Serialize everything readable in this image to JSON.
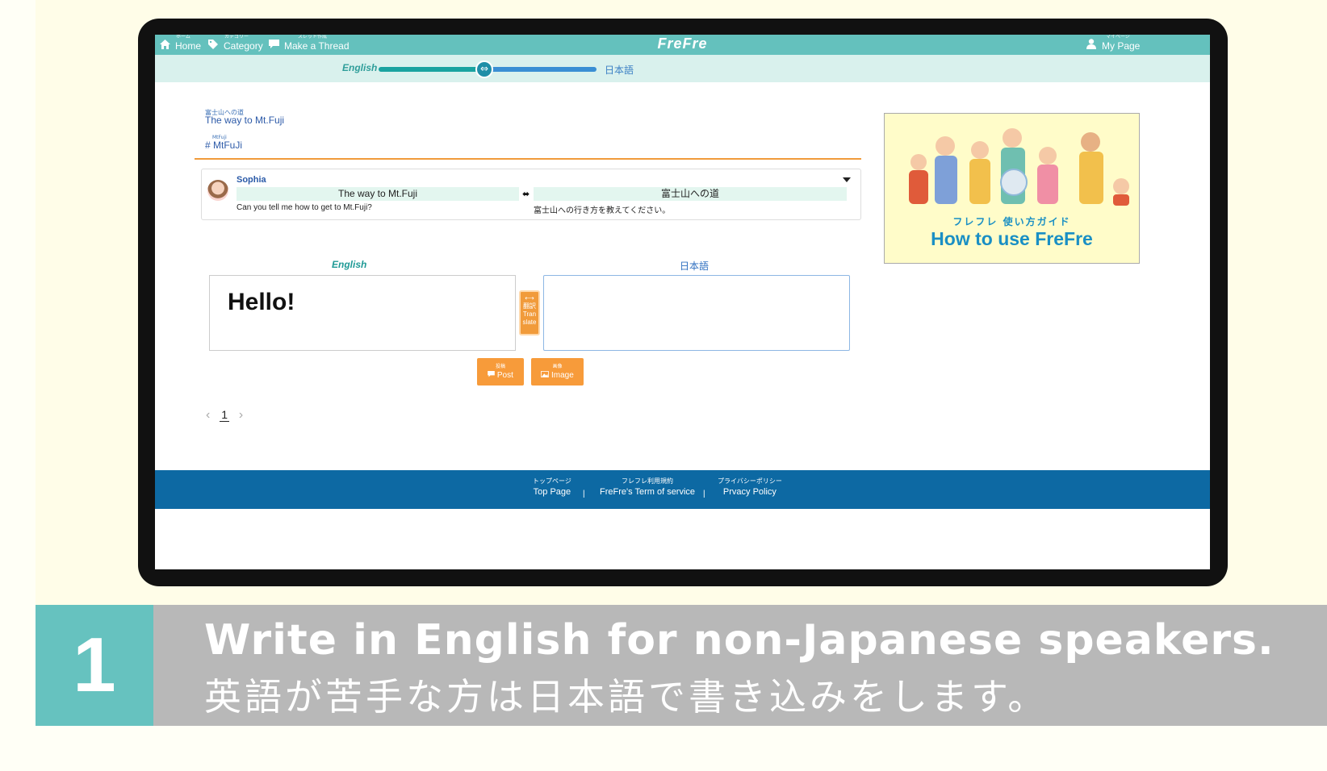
{
  "nav": {
    "home": {
      "ruby": "ホーム",
      "label": "Home"
    },
    "category": {
      "ruby": "カテゴリー",
      "label": "Category"
    },
    "make_thread": {
      "ruby": "スレッド作成",
      "label": "Make a Thread"
    },
    "brand": "FreFre",
    "my_page": {
      "ruby": "マイページ",
      "label": "My Page"
    }
  },
  "lang_toggle": {
    "left": "English",
    "right": "日本語",
    "knob": "⇔"
  },
  "thread": {
    "title_ruby": "富士山への道",
    "title": "The way to Mt.Fuji",
    "tag_ruby": "MtFuji",
    "tag": "# MtFuJi"
  },
  "post": {
    "user": "Sophia",
    "title_en": "The way to Mt.Fuji",
    "arrow": "⬌",
    "title_ja": "富士山への道",
    "body_en": "Can you tell me how to get to Mt.Fuji?",
    "body_ja": "富士山への行き方を教えてください。"
  },
  "editor": {
    "label_en": "English",
    "label_ja": "日本語",
    "text_en": "Hello!",
    "text_ja": "",
    "translate": {
      "arrow": "⟷",
      "ruby": "翻訳",
      "label_line1": "Tran",
      "label_line2": "slate"
    },
    "post_button": {
      "ruby": "投稿",
      "label": "Post"
    },
    "image_button": {
      "ruby": "画像",
      "label": "Image"
    }
  },
  "pager": {
    "prev": "‹",
    "page": "1",
    "next": "›"
  },
  "ad": {
    "subtitle": "フレフレ 使い方ガイド",
    "title": "How to use FreFre"
  },
  "footer": {
    "links": [
      {
        "ruby": "トップページ",
        "label": "Top Page"
      },
      {
        "ruby": "フレフレ利用規約",
        "label": "FreFre's Term of service"
      },
      {
        "ruby": "プライバシーポリシー",
        "label": "Prvacy Policy"
      }
    ],
    "separator": "|"
  },
  "caption": {
    "step": "1",
    "en": "Write in English for non-Japanese speakers.",
    "ja": "英語が苦手な方は日本語で書き込みをします。"
  },
  "colors": {
    "topbar": "#64c1bd",
    "subbar": "#d9f1ed",
    "accent_orange": "#f19b3b",
    "footer": "#0d69a3",
    "caption_bg": "#b8b8b8",
    "step_badge": "#66c2bf"
  }
}
